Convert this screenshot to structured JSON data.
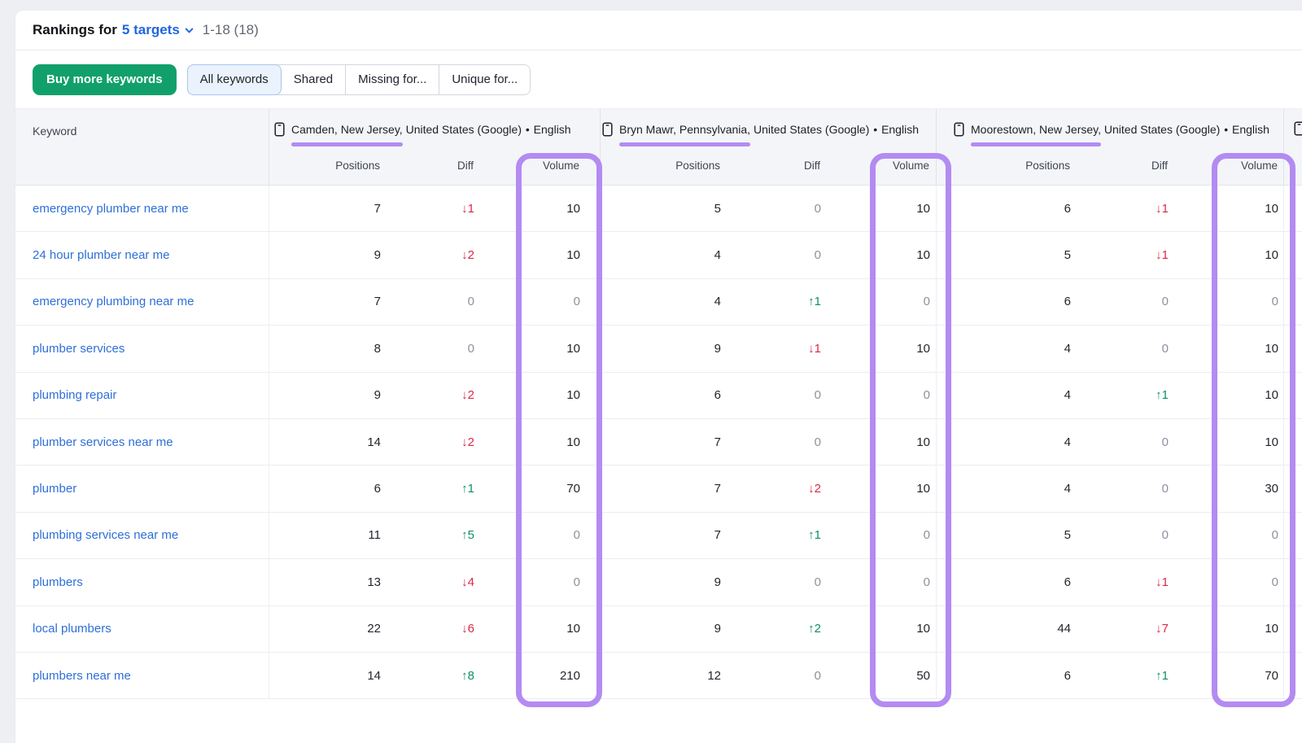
{
  "header": {
    "title_prefix": "Rankings for",
    "targets_link": "5 targets",
    "range_text": "1-18 (18)"
  },
  "toolbar": {
    "buy_button_label": "Buy more keywords",
    "tabs": [
      {
        "label": "All keywords",
        "selected": true
      },
      {
        "label": "Shared",
        "selected": false
      },
      {
        "label": "Missing for...",
        "selected": false
      },
      {
        "label": "Unique for...",
        "selected": false
      }
    ]
  },
  "table": {
    "keyword_header": "Keyword",
    "metric_headers": {
      "positions": "Positions",
      "diff": "Diff",
      "volume": "Volume"
    },
    "targets": [
      {
        "name_underlined": "Camden, New Jersey,",
        "name_rest": "United States (Google)",
        "bullet": "•",
        "language": "English"
      },
      {
        "name_underlined": "Bryn Mawr, Pennsylvania,",
        "name_rest": "United States (Google)",
        "bullet": "•",
        "language": "English"
      },
      {
        "name_underlined": "Moorestown, New Jersey,",
        "name_rest": "United States (Google)",
        "bullet": "•",
        "language": "English"
      }
    ],
    "rows": [
      {
        "keyword": "emergency plumber near me",
        "metrics": [
          {
            "positions": "7",
            "diff": "↓1",
            "diff_tone": "down",
            "volume": "10"
          },
          {
            "positions": "5",
            "diff": "0",
            "diff_tone": "flat",
            "volume": "10"
          },
          {
            "positions": "6",
            "diff": "↓1",
            "diff_tone": "down",
            "volume": "10"
          }
        ]
      },
      {
        "keyword": "24 hour plumber near me",
        "metrics": [
          {
            "positions": "9",
            "diff": "↓2",
            "diff_tone": "down",
            "volume": "10"
          },
          {
            "positions": "4",
            "diff": "0",
            "diff_tone": "flat",
            "volume": "10"
          },
          {
            "positions": "5",
            "diff": "↓1",
            "diff_tone": "down",
            "volume": "10"
          }
        ]
      },
      {
        "keyword": "emergency plumbing near me",
        "metrics": [
          {
            "positions": "7",
            "diff": "0",
            "diff_tone": "flat",
            "volume": "0"
          },
          {
            "positions": "4",
            "diff": "↑1",
            "diff_tone": "up",
            "volume": "0"
          },
          {
            "positions": "6",
            "diff": "0",
            "diff_tone": "flat",
            "volume": "0"
          }
        ]
      },
      {
        "keyword": "plumber services",
        "metrics": [
          {
            "positions": "8",
            "diff": "0",
            "diff_tone": "flat",
            "volume": "10"
          },
          {
            "positions": "9",
            "diff": "↓1",
            "diff_tone": "down",
            "volume": "10"
          },
          {
            "positions": "4",
            "diff": "0",
            "diff_tone": "flat",
            "volume": "10"
          }
        ]
      },
      {
        "keyword": "plumbing repair",
        "metrics": [
          {
            "positions": "9",
            "diff": "↓2",
            "diff_tone": "down",
            "volume": "10"
          },
          {
            "positions": "6",
            "diff": "0",
            "diff_tone": "flat",
            "volume": "0"
          },
          {
            "positions": "4",
            "diff": "↑1",
            "diff_tone": "up",
            "volume": "10"
          }
        ]
      },
      {
        "keyword": "plumber services near me",
        "metrics": [
          {
            "positions": "14",
            "diff": "↓2",
            "diff_tone": "down",
            "volume": "10"
          },
          {
            "positions": "7",
            "diff": "0",
            "diff_tone": "flat",
            "volume": "10"
          },
          {
            "positions": "4",
            "diff": "0",
            "diff_tone": "flat",
            "volume": "10"
          }
        ]
      },
      {
        "keyword": "plumber",
        "metrics": [
          {
            "positions": "6",
            "diff": "↑1",
            "diff_tone": "up",
            "volume": "70"
          },
          {
            "positions": "7",
            "diff": "↓2",
            "diff_tone": "down",
            "volume": "10"
          },
          {
            "positions": "4",
            "diff": "0",
            "diff_tone": "flat",
            "volume": "30"
          }
        ]
      },
      {
        "keyword": "plumbing services near me",
        "metrics": [
          {
            "positions": "11",
            "diff": "↑5",
            "diff_tone": "up",
            "volume": "0"
          },
          {
            "positions": "7",
            "diff": "↑1",
            "diff_tone": "up",
            "volume": "0"
          },
          {
            "positions": "5",
            "diff": "0",
            "diff_tone": "flat",
            "volume": "0"
          }
        ]
      },
      {
        "keyword": "plumbers",
        "metrics": [
          {
            "positions": "13",
            "diff": "↓4",
            "diff_tone": "down",
            "volume": "0"
          },
          {
            "positions": "9",
            "diff": "0",
            "diff_tone": "flat",
            "volume": "0"
          },
          {
            "positions": "6",
            "diff": "↓1",
            "diff_tone": "down",
            "volume": "0"
          }
        ]
      },
      {
        "keyword": "local plumbers",
        "metrics": [
          {
            "positions": "22",
            "diff": "↓6",
            "diff_tone": "down",
            "volume": "10"
          },
          {
            "positions": "9",
            "diff": "↑2",
            "diff_tone": "up",
            "volume": "10"
          },
          {
            "positions": "44",
            "diff": "↓7",
            "diff_tone": "down",
            "volume": "10"
          }
        ]
      },
      {
        "keyword": "plumbers near me",
        "metrics": [
          {
            "positions": "14",
            "diff": "↑8",
            "diff_tone": "up",
            "volume": "210"
          },
          {
            "positions": "12",
            "diff": "0",
            "diff_tone": "flat",
            "volume": "50"
          },
          {
            "positions": "6",
            "diff": "↑1",
            "diff_tone": "up",
            "volume": "70"
          }
        ]
      }
    ]
  },
  "colors": {
    "accent_purple": "#b38bf2",
    "buy_button_green": "#11a06c",
    "diff_down_red": "#dc2749",
    "diff_up_green": "#0e8f68",
    "link_blue": "#2e6fd8",
    "targets_link_blue": "#1f66dd",
    "selected_tab_bg": "#eaf2fd",
    "header_bg": "#f4f5f8"
  }
}
